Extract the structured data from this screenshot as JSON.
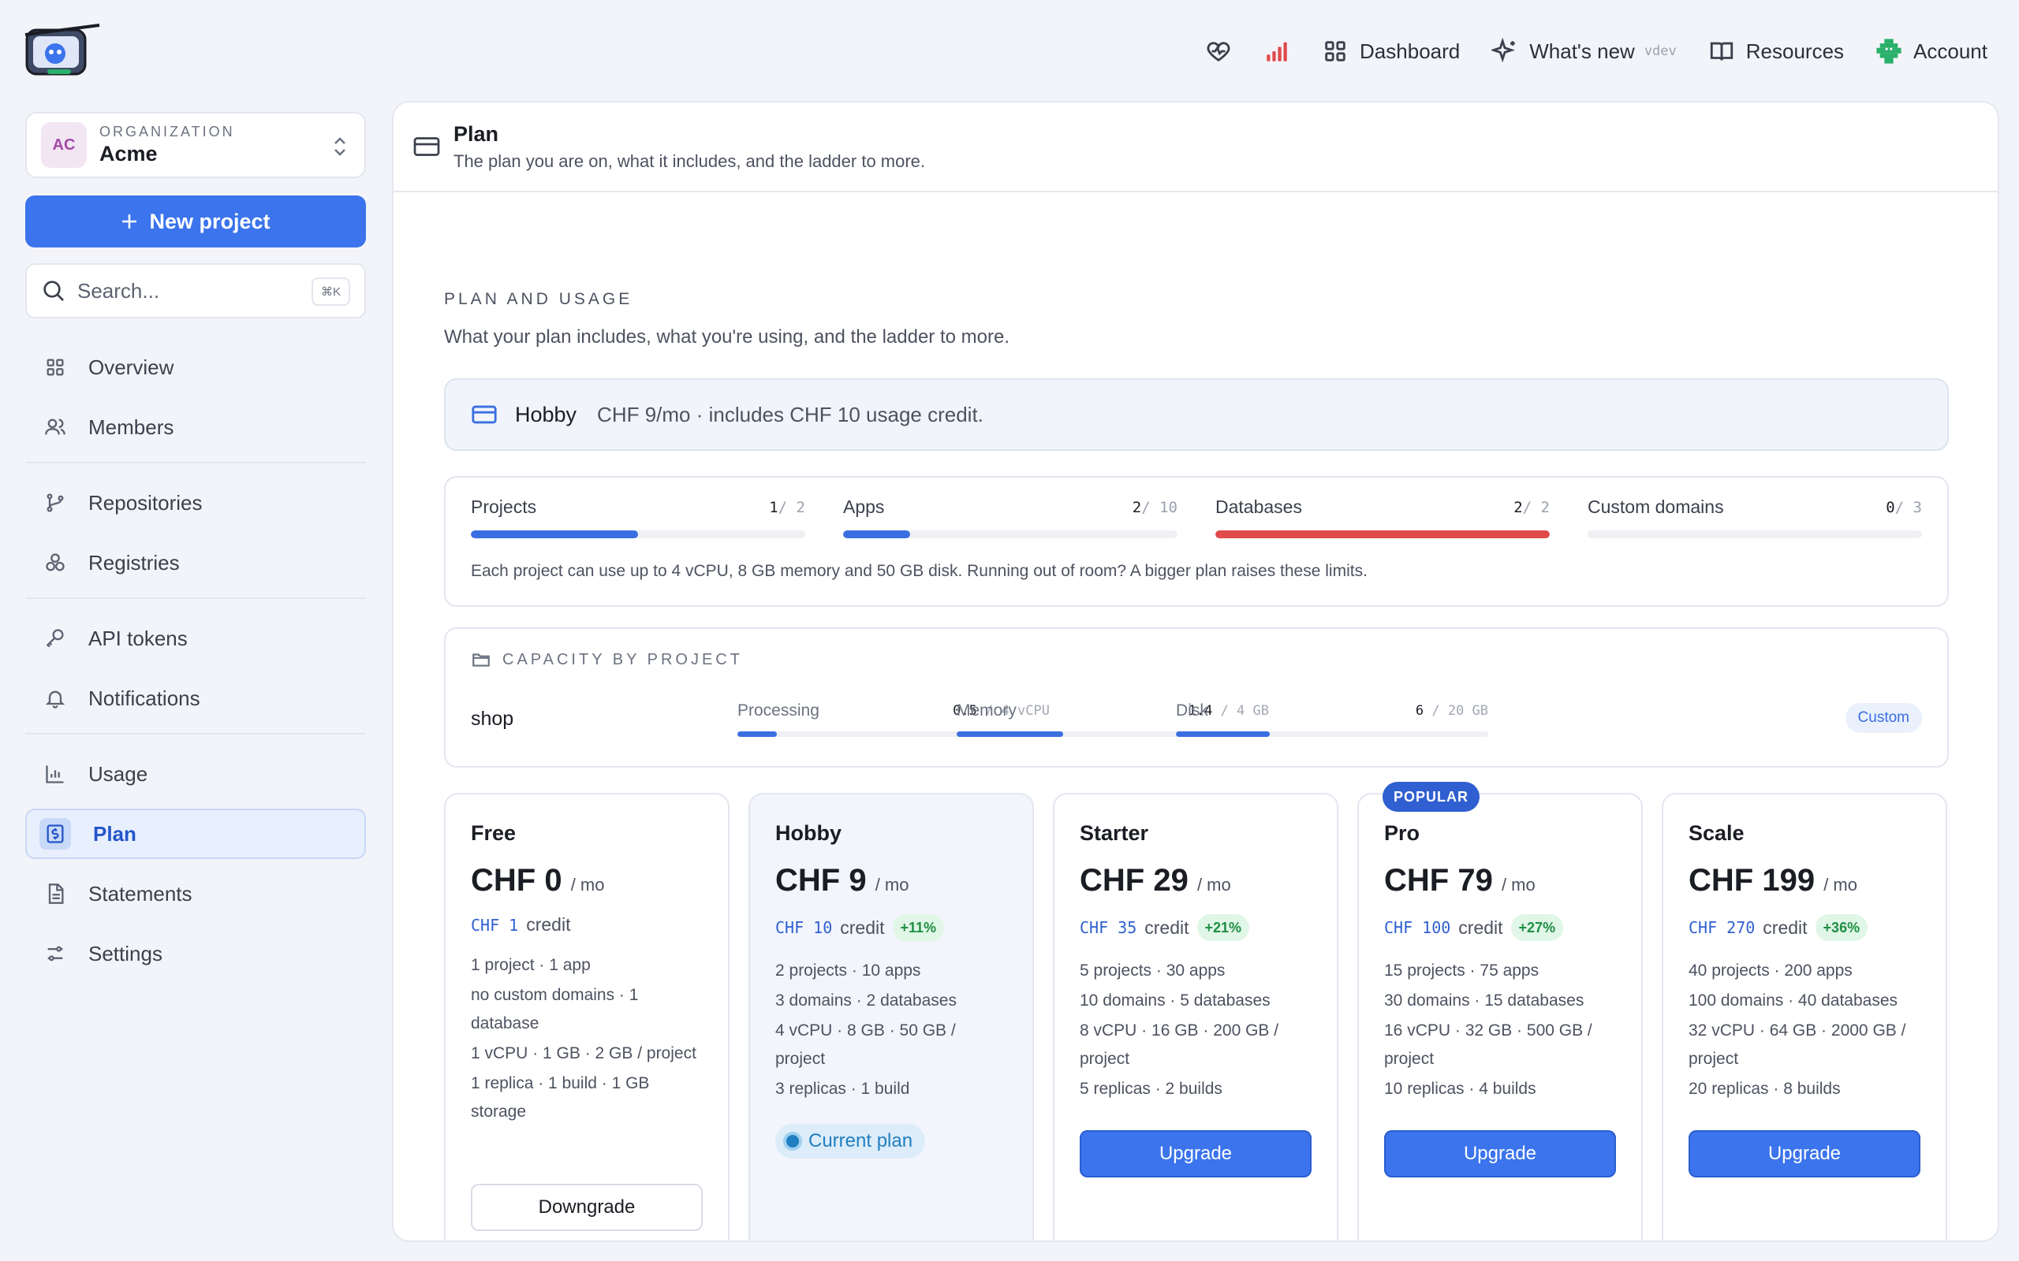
{
  "topnav": {
    "dashboard": "Dashboard",
    "whats_new": "What's new",
    "whats_new_tag": "vdev",
    "resources": "Resources",
    "account": "Account"
  },
  "sidebar": {
    "org": {
      "initials": "AC",
      "kicker": "ORGANIZATION",
      "name": "Acme"
    },
    "new_project": "New project",
    "search_placeholder": "Search...",
    "search_shortcut": "⌘K",
    "items": [
      {
        "label": "Overview",
        "icon": "grid-icon"
      },
      {
        "label": "Members",
        "icon": "users-icon"
      },
      {
        "label": "Repositories",
        "icon": "git-branch-icon"
      },
      {
        "label": "Registries",
        "icon": "boxes-icon"
      },
      {
        "label": "API tokens",
        "icon": "key-icon"
      },
      {
        "label": "Notifications",
        "icon": "bell-icon"
      },
      {
        "label": "Usage",
        "icon": "bar-chart-icon"
      },
      {
        "label": "Plan",
        "icon": "receipt-icon",
        "active": true
      },
      {
        "label": "Statements",
        "icon": "document-icon"
      },
      {
        "label": "Settings",
        "icon": "sliders-icon"
      }
    ]
  },
  "header": {
    "title": "Plan",
    "subtitle": "The plan you are on, what it includes, and the ladder to more."
  },
  "plan_usage": {
    "kicker": "PLAN AND USAGE",
    "description": "What your plan includes, what you're using, and the ladder to more.",
    "current_plan_name": "Hobby",
    "current_plan_desc": "CHF 9/mo · includes CHF 10 usage credit."
  },
  "limits": {
    "items": [
      {
        "label": "Projects",
        "used": "1",
        "max": "/ 2",
        "fraction": 0.5,
        "color": "#3b6ee0"
      },
      {
        "label": "Apps",
        "used": "2",
        "max": "/ 10",
        "fraction": 0.2,
        "color": "#3b6ee0"
      },
      {
        "label": "Databases",
        "used": "2",
        "max": "/ 2",
        "fraction": 1.0,
        "color": "#e04a4a"
      },
      {
        "label": "Custom domains",
        "used": "0",
        "max": "/ 3",
        "fraction": 0.0,
        "color": "#3b6ee0"
      }
    ],
    "note": "Each project can use up to 4 vCPU, 8 GB memory and 50 GB disk. Running out of room? A bigger plan raises these limits."
  },
  "capacity": {
    "kicker": "CAPACITY BY PROJECT",
    "project": "shop",
    "metrics": [
      {
        "label": "Processing",
        "used": "0.5",
        "max": "/ 4 vCPU",
        "fraction": 0.125
      },
      {
        "label": "Memory",
        "used": "1.4",
        "max": "/ 4 GB",
        "fraction": 0.34
      },
      {
        "label": "Disk",
        "used": "6",
        "max": "/ 20 GB",
        "fraction": 0.3
      }
    ],
    "badge": "Custom"
  },
  "tiers": [
    {
      "name": "Free",
      "price": "CHF 0",
      "per": "/ mo",
      "credit_amt": "CHF 1",
      "credit_lbl": "credit",
      "pct": "",
      "features": [
        "1 project · 1 app",
        "no custom domains · 1 database",
        "1 vCPU · 1 GB · 2 GB / project",
        "1 replica · 1 build · 1 GB storage"
      ],
      "action": "Downgrade",
      "type": "down"
    },
    {
      "name": "Hobby",
      "price": "CHF 9",
      "per": "/ mo",
      "credit_amt": "CHF 10",
      "credit_lbl": "credit",
      "pct": "+11%",
      "features": [
        "2 projects · 10 apps",
        "3 domains · 2 databases",
        "4 vCPU · 8 GB · 50 GB / project",
        "3 replicas · 1 build"
      ],
      "action": "Current plan",
      "type": "current"
    },
    {
      "name": "Starter",
      "price": "CHF 29",
      "per": "/ mo",
      "credit_amt": "CHF 35",
      "credit_lbl": "credit",
      "pct": "+21%",
      "features": [
        "5 projects · 30 apps",
        "10 domains · 5 databases",
        "8 vCPU · 16 GB · 200 GB / project",
        "5 replicas · 2 builds"
      ],
      "action": "Upgrade",
      "type": "up"
    },
    {
      "name": "Pro",
      "price": "CHF 79",
      "per": "/ mo",
      "credit_amt": "CHF 100",
      "credit_lbl": "credit",
      "pct": "+27%",
      "features": [
        "15 projects · 75 apps",
        "30 domains · 15 databases",
        "16 vCPU · 32 GB · 500 GB / project",
        "10 replicas · 4 builds"
      ],
      "action": "Upgrade",
      "type": "up",
      "badge": "POPULAR"
    },
    {
      "name": "Scale",
      "price": "CHF 199",
      "per": "/ mo",
      "credit_amt": "CHF 270",
      "credit_lbl": "credit",
      "pct": "+36%",
      "features": [
        "40 projects · 200 apps",
        "100 domains · 40 databases",
        "32 vCPU · 64 GB · 2000 GB / project",
        "20 replicas · 8 builds"
      ],
      "action": "Upgrade",
      "type": "up"
    }
  ],
  "colors": {
    "accent": "#3b74ec",
    "danger": "#e04a4a",
    "success": "#1f8f45"
  }
}
